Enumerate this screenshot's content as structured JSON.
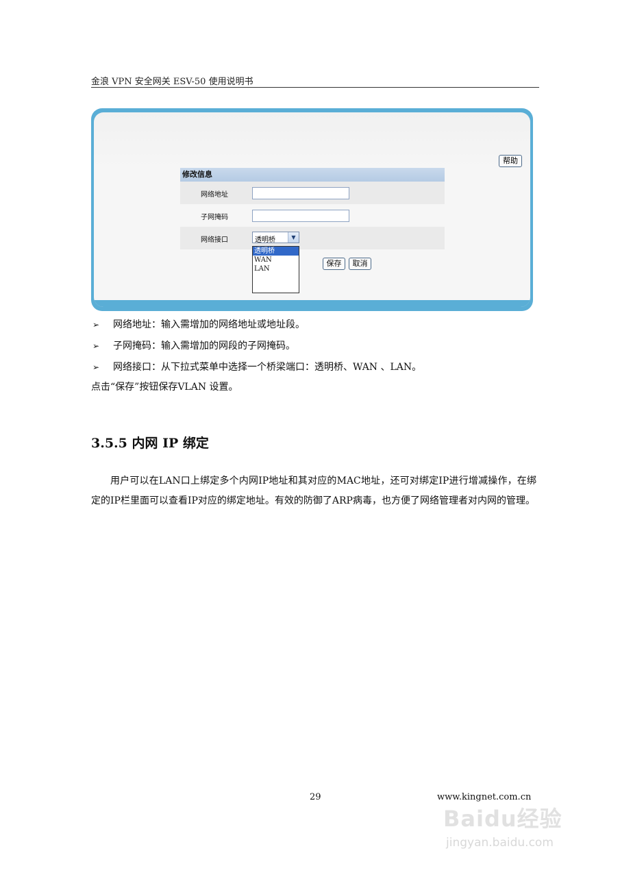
{
  "header": {
    "title": "金浪 VPN 安全网关 ESV-50 使用说明书"
  },
  "screenshot": {
    "help_label": "帮助",
    "form_title": "修改信息",
    "fields": [
      {
        "label": "网络地址",
        "value": ""
      },
      {
        "label": "子网掩码",
        "value": ""
      },
      {
        "label": "网络接口",
        "value": "透明桥"
      }
    ],
    "dropdown_options": [
      "透明桥",
      "WAN",
      "LAN"
    ],
    "save_label": "保存",
    "cancel_label": "取消"
  },
  "bullets": [
    {
      "marker": "➢",
      "text": "网络地址：输入需增加的网络地址或地址段。"
    },
    {
      "marker": "➢",
      "text": "子网掩码：输入需增加的网段的子网掩码。"
    },
    {
      "marker": "➢",
      "text": "网络接口：从下拉式菜单中选择一个桥梁端口：透明桥、WAN 、LAN。"
    }
  ],
  "note": "点击“保存”按钮保存VLAN 设置。",
  "section": {
    "title": "3.5.5  内网 IP 绑定"
  },
  "paragraph": "用户可以在LAN口上绑定多个内网IP地址和其对应的MAC地址，还可对绑定IP进行增减操作，在绑定的IP栏里面可以查看IP对应的绑定地址。有效的防御了ARP病毒，也方便了网络管理者对内网的管理。",
  "footer": {
    "page_number": "29",
    "url": "www.kingnet.com.cn"
  },
  "watermark": {
    "logo": "Baidu经验",
    "sub": "jingyan.baidu.com"
  }
}
